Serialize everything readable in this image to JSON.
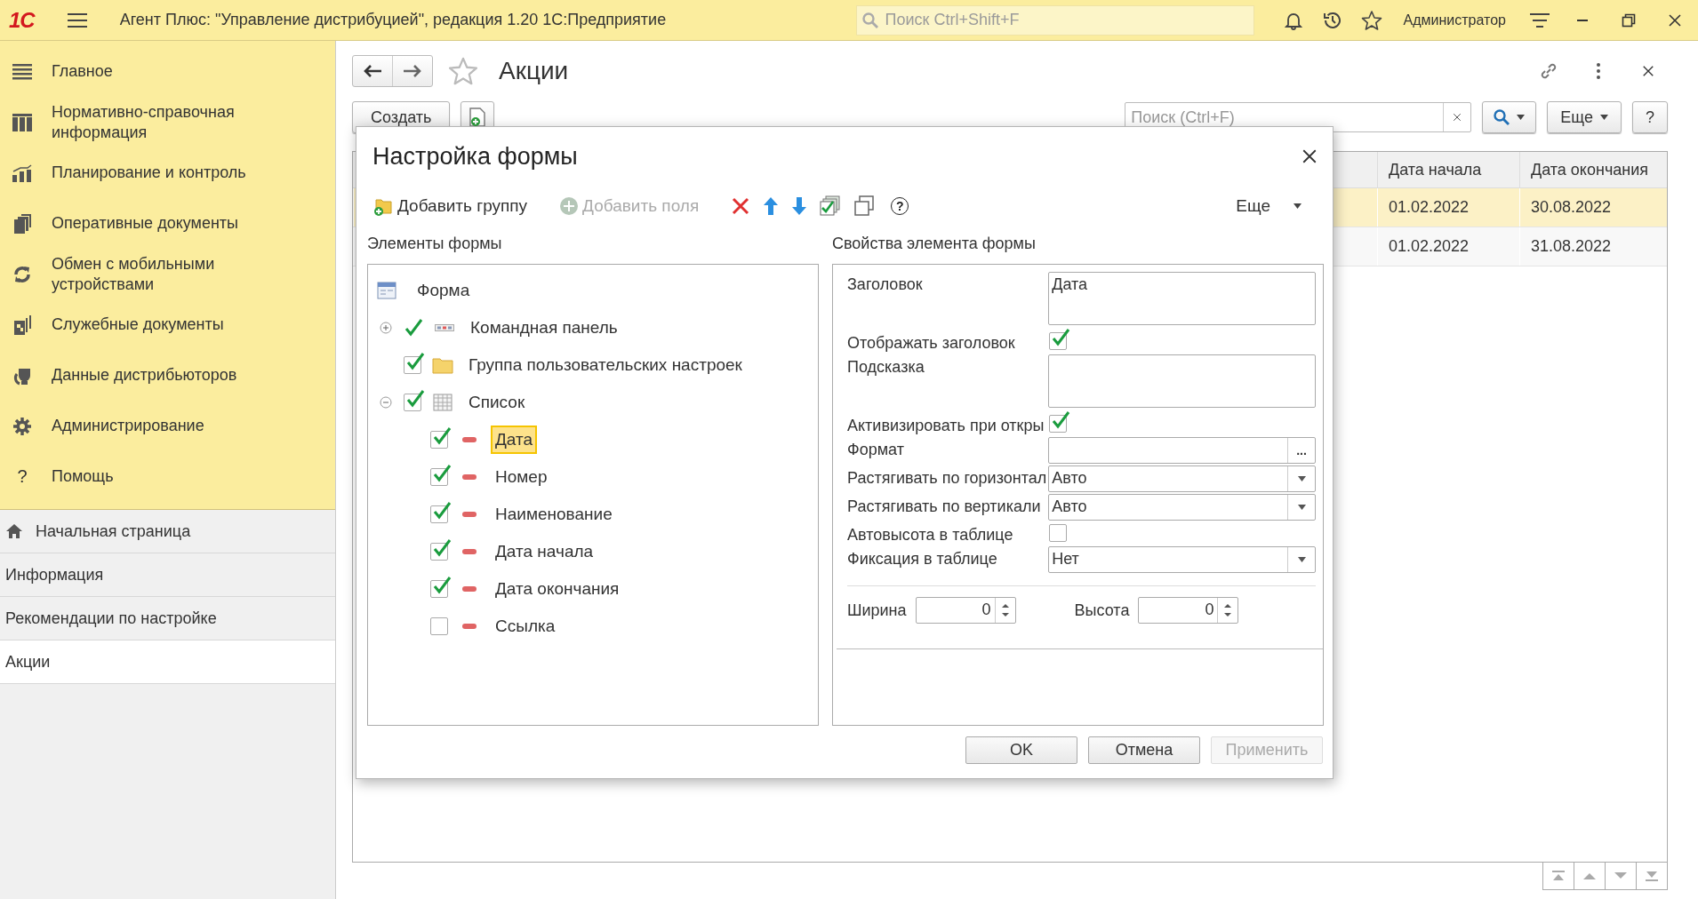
{
  "app": {
    "logo": "1С",
    "title": "Агент Плюс: \"Управление дистрибуцией\", редакция 1.20 1С:Предприятие",
    "search_placeholder": "Поиск Ctrl+Shift+F",
    "user": "Администратор"
  },
  "sidebar": {
    "sections": [
      {
        "label": "Главное"
      },
      {
        "label": "Нормативно-справочная информация"
      },
      {
        "label": "Планирование и контроль"
      },
      {
        "label": "Оперативные документы"
      },
      {
        "label": "Обмен с мобильными устройствами"
      },
      {
        "label": "Служебные документы"
      },
      {
        "label": "Данные дистрибьюторов"
      },
      {
        "label": "Администрирование"
      },
      {
        "label": "Помощь",
        "glyph": "?"
      }
    ],
    "open_pages": [
      {
        "label": "Начальная страница",
        "kind": "home",
        "selected": false
      },
      {
        "label": "Информация",
        "kind": "page",
        "selected": false
      },
      {
        "label": "Рекомендации по настройке",
        "kind": "page",
        "selected": false
      },
      {
        "label": "Акции",
        "kind": "page",
        "selected": true
      }
    ]
  },
  "form": {
    "title": "Акции",
    "create_button": "Создать",
    "search_placeholder": "Поиск (Ctrl+F)",
    "more_button": "Еще",
    "help_button": "?",
    "table": {
      "columns": [
        "Дата начала",
        "Дата окончания"
      ],
      "rows": [
        {
          "cells": [
            "01.02.2022",
            "30.08.2022"
          ],
          "selected": true
        },
        {
          "cells": [
            "01.02.2022",
            "31.08.2022"
          ],
          "selected": false
        }
      ]
    }
  },
  "dialog": {
    "title": "Настройка формы",
    "toolbar": [
      {
        "kind": "add-group",
        "label": "Добавить группу",
        "disabled": false
      },
      {
        "kind": "add-fields",
        "label": "Добавить поля",
        "disabled": true
      },
      {
        "kind": "delete"
      },
      {
        "kind": "up"
      },
      {
        "kind": "down"
      },
      {
        "kind": "check-all"
      },
      {
        "kind": "copy"
      },
      {
        "kind": "help",
        "glyph": "?"
      }
    ],
    "more": "Еще",
    "elements_label": "Элементы формы",
    "tree": {
      "label": "Форма",
      "children": [
        {
          "kind": "command-bar",
          "label": "Командная панель",
          "checked": true,
          "expanded": false
        },
        {
          "kind": "group",
          "label": "Группа пользовательских настроек",
          "checked": true
        },
        {
          "kind": "table",
          "label": "Список",
          "checked": true,
          "expanded": true,
          "children": [
            {
              "kind": "field",
              "label": "Дата",
              "checked": true,
              "selected": true
            },
            {
              "kind": "field",
              "label": "Номер",
              "checked": true,
              "selected": false
            },
            {
              "kind": "field",
              "label": "Наименование",
              "checked": true,
              "selected": false
            },
            {
              "kind": "field",
              "label": "Дата начала",
              "checked": true,
              "selected": false
            },
            {
              "kind": "field",
              "label": "Дата окончания",
              "checked": true,
              "selected": false
            },
            {
              "kind": "field",
              "label": "Ссылка",
              "checked": false,
              "selected": false
            }
          ]
        }
      ]
    },
    "properties_label": "Свойства элемента формы",
    "properties": [
      {
        "kind": "text-area",
        "label": "Заголовок",
        "value": "Дата"
      },
      {
        "kind": "checkbox",
        "label": "Отображать заголовок",
        "checked": true
      },
      {
        "kind": "text-area",
        "label": "Подсказка"
      },
      {
        "kind": "checkbox",
        "label": "Активизировать при откры",
        "checked": true
      },
      {
        "kind": "choice",
        "label": "Формат",
        "button": "..."
      },
      {
        "kind": "select",
        "label": "Растягивать по горизонтал",
        "value": "Авто"
      },
      {
        "kind": "select",
        "label": "Растягивать по вертикали",
        "value": "Авто"
      },
      {
        "kind": "checkbox",
        "label": "Автовысота в таблице",
        "checked": false
      },
      {
        "kind": "select",
        "label": "Фиксация в таблице",
        "value": "Нет"
      }
    ],
    "size": [
      {
        "label": "Ширина",
        "value": "0"
      },
      {
        "label": "Высота",
        "value": "0"
      }
    ],
    "buttons": [
      {
        "label": "OK",
        "disabled": false
      },
      {
        "label": "Отмена",
        "disabled": false
      },
      {
        "label": "Применить",
        "disabled": true
      }
    ]
  }
}
